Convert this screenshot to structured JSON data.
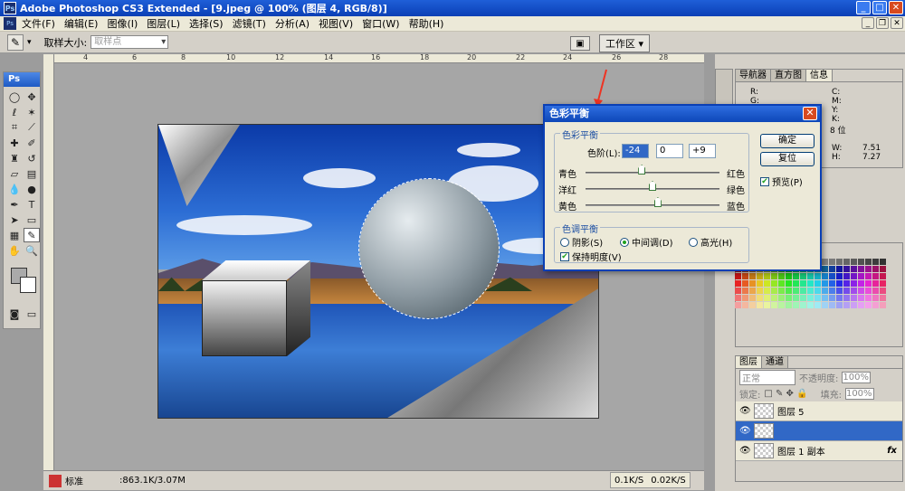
{
  "app": {
    "title": "Adobe Photoshop CS3 Extended - [9.jpeg @ 100% (图层 4, RGB/8)]",
    "logo": "Ps"
  },
  "menu": [
    "文件(F)",
    "编辑(E)",
    "图像(I)",
    "图层(L)",
    "选择(S)",
    "滤镜(T)",
    "分析(A)",
    "视图(V)",
    "窗口(W)",
    "帮助(H)"
  ],
  "options": {
    "sample_size_label": "取样大小:",
    "sample_size_value": "取样点",
    "workspace_label": "工作区 ▾"
  },
  "ruler_top": [
    "4",
    "6",
    "8",
    "10",
    "12",
    "14",
    "16",
    "18",
    "20",
    "22",
    "24",
    "26",
    "28"
  ],
  "status": {
    "zoom": "标准",
    "doc": ":863.1K/3.07M",
    "net_down": "0.1K/S",
    "net_up": "0.02K/S"
  },
  "right_panels": {
    "tabs": [
      "导航器",
      "直方图",
      "信息"
    ],
    "info_left": [
      "R:",
      "G:",
      "B:"
    ],
    "info_right": [
      "C:",
      "M:",
      "Y:",
      "K:",
      "8 位"
    ],
    "dims": [
      "W:",
      "7.51",
      "H:",
      "7.27"
    ]
  },
  "layers_panel": {
    "tabs": [
      "图层",
      "通道"
    ],
    "blend_mode": "正常",
    "opacity_label": "不透明度:",
    "opacity_value": "100%",
    "lock_label": "锁定:",
    "fill_label": "填充:",
    "fill_value": "100%",
    "rows": [
      {
        "name": "图层 5",
        "selected": false
      },
      {
        "name": "",
        "selected": true
      },
      {
        "name": "图层 1 副本",
        "selected": false
      }
    ],
    "fx": "fx"
  },
  "dialog": {
    "title": "色彩平衡",
    "group1": "色彩平衡",
    "levels_label": "色阶(L):",
    "level1": "-24",
    "level2": "0",
    "level3": "+9",
    "sliders": [
      {
        "left": "青色",
        "right": "红色",
        "pos": 0.42
      },
      {
        "left": "洋红",
        "right": "绿色",
        "pos": 0.5
      },
      {
        "left": "黄色",
        "right": "蓝色",
        "pos": 0.54
      }
    ],
    "group2": "色调平衡",
    "shadows": "阴影(S)",
    "midtones": "中间调(D)",
    "highlights": "高光(H)",
    "preserve": "保持明度(V)",
    "ok": "确定",
    "reset": "复位",
    "preview": "预览(P)"
  }
}
